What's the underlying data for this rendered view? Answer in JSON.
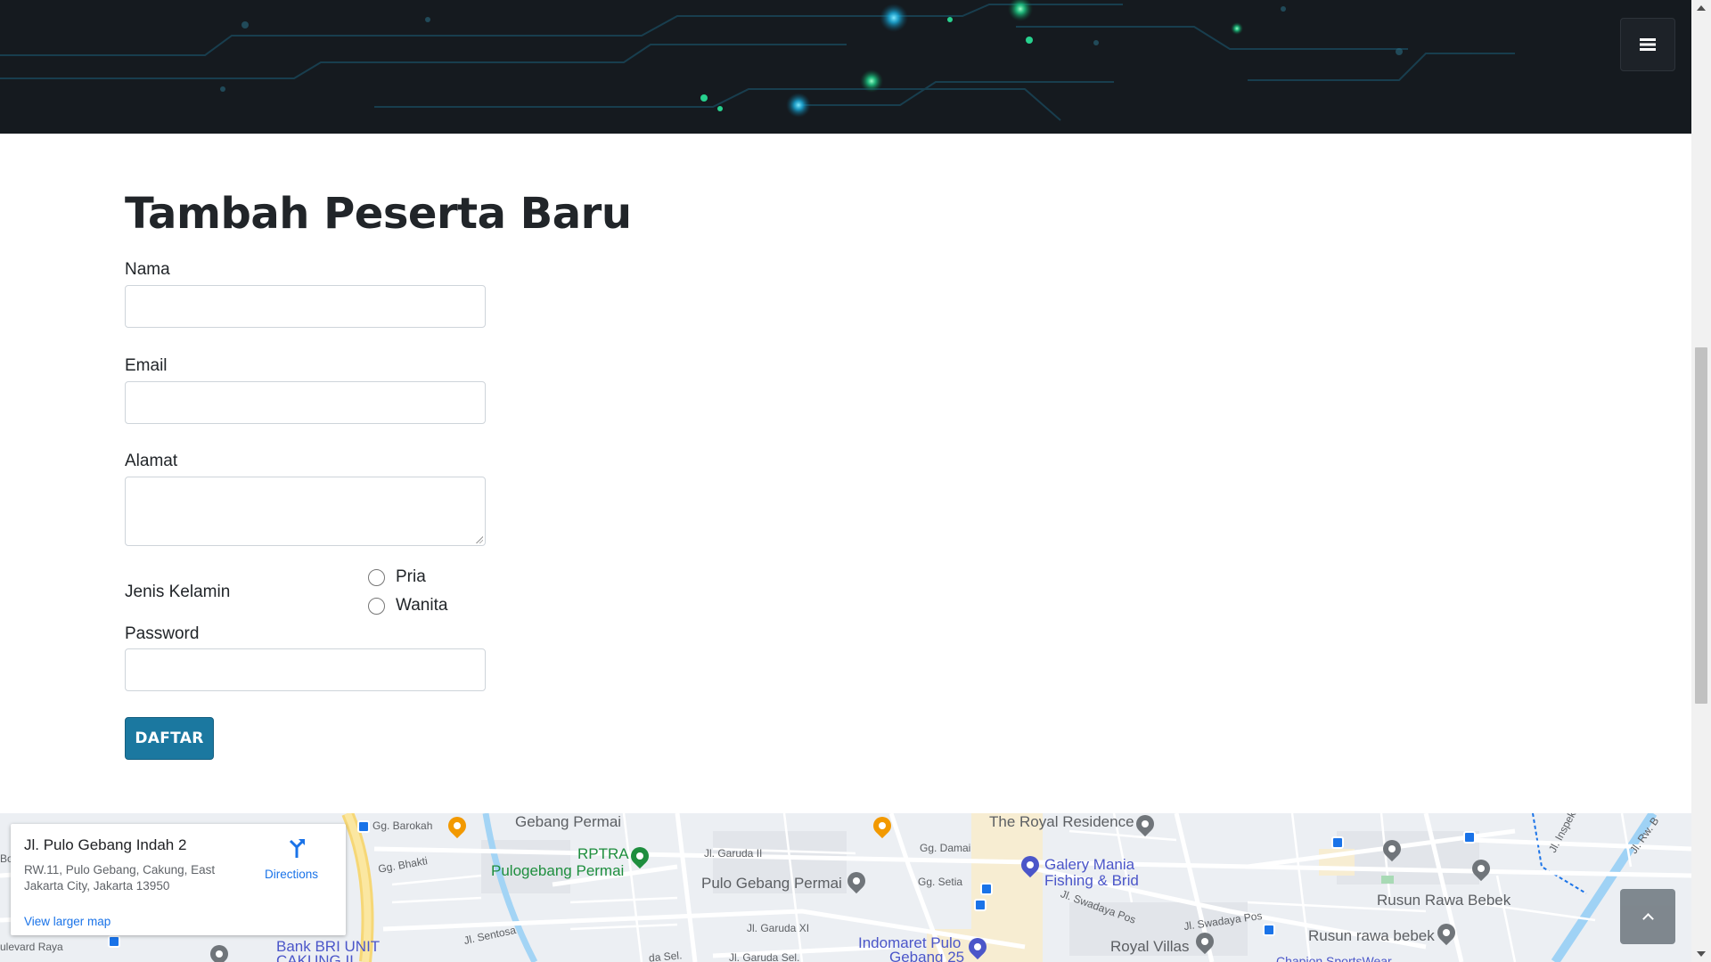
{
  "form": {
    "title": "Tambah Peserta Baru",
    "fields": {
      "nama_label": "Nama",
      "nama_value": "",
      "email_label": "Email",
      "email_value": "",
      "alamat_label": "Alamat",
      "alamat_value": "",
      "gender_label": "Jenis Kelamin",
      "gender_options": [
        "Pria",
        "Wanita"
      ],
      "password_label": "Password",
      "password_value": ""
    },
    "submit_label": "DAFTAR"
  },
  "map": {
    "place_name": "Jl. Pulo Gebang Indah 2",
    "address": "RW.11, Pulo Gebang, Cakung, East Jakarta City, Jakarta 13950",
    "directions_label": "Directions",
    "larger_map_label": "View larger map",
    "labels": {
      "barokah": "Gg. Barokah",
      "gebang_permai": "Gebang Permai",
      "royal_residence": "The Royal Residence",
      "bhakti": "Gg. Bhakti",
      "rptra_1": "RPTRA",
      "rptra_2": "Pulogebang Permai",
      "garuda_ii": "Jl. Garuda II",
      "damai": "Gg. Damai",
      "galery_1": "Galery Mania",
      "galery_2": "Fishing & Brid",
      "setia": "Gg. Setia",
      "pulo_gebang_permai": "Pulo Gebang Permai",
      "swadaya_pos": "Jl. Swadaya Pos",
      "swadaya_pos_2": "Jl. Swadaya Pos",
      "rusun_rawa_bebek": "Rusun Rawa Bebek",
      "rusun_rawa_bebek_2": "Rusun rawa bebek",
      "garuda_xi": "Jl. Garuda XI",
      "sentosa": "Jl. Sentosa",
      "bank_bri_1": "Bank BRI UNIT",
      "bank_bri_2": "CAKUNG II",
      "indomaret_1": "Indomaret Pulo",
      "indomaret_2": "Gebang 25",
      "royal_villas": "Royal Villas",
      "boulevard_raya": "ulevard Raya",
      "inspeksi": "Jl. Inspeksi Kanal Tim",
      "garuda_sel": "Jl. Garuda Sel.",
      "da_sel": "da Sel.",
      "rw_b": "Jl. Rw. B",
      "champion": "Chapion SportsWear",
      "bo": "Bo"
    }
  },
  "colors": {
    "button_bg": "#1b78a0",
    "header_bg": "#151a1f",
    "scroll_top_bg": "#6c757d"
  },
  "icons": {
    "menu": "hamburger-menu-icon",
    "scroll_top": "chevron-up-icon",
    "directions": "directions-icon"
  }
}
